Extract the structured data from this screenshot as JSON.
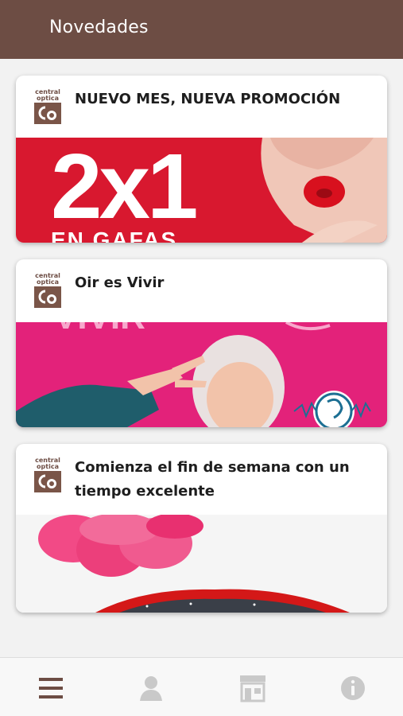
{
  "header": {
    "title": "Novedades"
  },
  "logo": {
    "line1": "central",
    "line2": "optica",
    "mark": "Co"
  },
  "cards": [
    {
      "title": "NUEVO MES, NUEVA PROMOCIÓN",
      "image_text": "2x1",
      "image_subtext": "EN GAFAS"
    },
    {
      "title": "Oir es Vivir",
      "image_text": "VIVIR"
    },
    {
      "title_line1": "Comienza el fin de semana con un",
      "title_line2": "tiempo excelente"
    }
  ],
  "tabbar": {
    "items": [
      {
        "icon": "menu-icon",
        "active": true
      },
      {
        "icon": "user-icon",
        "active": false
      },
      {
        "icon": "store-icon",
        "active": false
      },
      {
        "icon": "info-icon",
        "active": false
      }
    ]
  },
  "colors": {
    "brand": "#6d4d44",
    "inactive": "#c9c9c9"
  }
}
